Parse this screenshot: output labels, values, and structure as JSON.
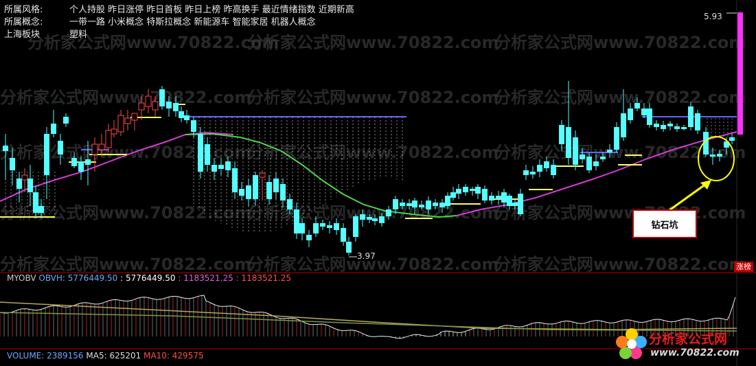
{
  "info": {
    "rows": [
      {
        "label": "所属风格:",
        "value": "个人持股 昨日涨停 昨日首板 昨日上榜 昨高换手 最近情绪指数 近期新高"
      },
      {
        "label": "所属概念:",
        "value": "一带一路 小米概念 特斯拉概念 新能源车 智能家居 机器人概念"
      },
      {
        "label": "上海板块",
        "value": "塑料"
      }
    ]
  },
  "main_chart": {
    "high_label": "5.93",
    "low_label": "3.97",
    "callout": "钻石坑",
    "tag": "涨榜",
    "watermark": "分析家公式网www.70822.com"
  },
  "obv_panel": {
    "name": "MYOBV",
    "obvh_label": "OBVH: 5776449.50",
    "value2": ": 5776449.50",
    "value3": ": 1183521.25",
    "value4": ": 1183521.25"
  },
  "volume_panel": {
    "volume_label": "VOLUME: 2389156",
    "ma5_label": "MA5: 625201",
    "ma10_label": "MA10: 429575"
  },
  "logo": {
    "brand": "分析家公式网",
    "url": "www.70822.com"
  },
  "colors": {
    "up": "#ff4a4a",
    "down": "#54ffff",
    "ma_magenta": "#d23cd2",
    "ma_green": "#4ad24a",
    "support": "#ffff66",
    "resistance": "#6464ff",
    "panel_line": "#b00000"
  }
}
